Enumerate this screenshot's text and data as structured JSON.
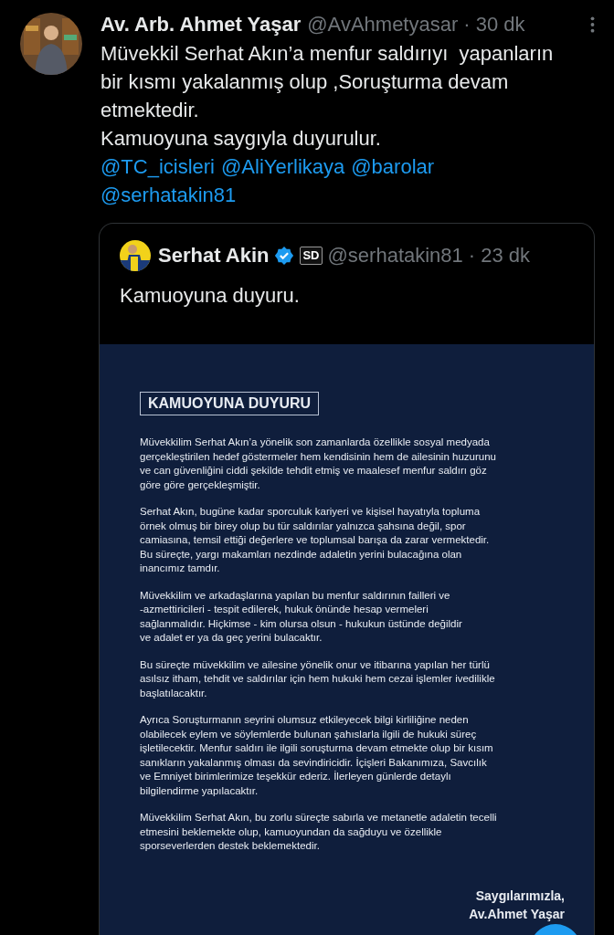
{
  "tweet": {
    "name": "Av. Arb. Ahmet Yaşar",
    "handle": "@AvAhmetyasar",
    "time": "· 30 dk",
    "text_lines": [
      "Müvekkil Serhat Akın’a menfur saldırıyı  yapanların",
      "bir kısmı yakalanmış olup ,Soruşturma devam",
      "etmektedir.",
      "Kamuoyuna saygıyla duyurulur."
    ],
    "mention_lines": [
      [
        "@TC_icisleri",
        "@AliYerlikaya",
        "@barolar"
      ],
      [
        "@serhatakin81"
      ]
    ]
  },
  "quote": {
    "name": "Serhat Akin",
    "verified": true,
    "badge": "SD",
    "handle": "@serhatakin81",
    "time": "· 23 dk",
    "text": "Kamuoyuna duyuru.",
    "document": {
      "heading": "KAMUOYUNA DUYURU",
      "paragraphs": [
        [
          "Müvekkilim Serhat Akın’a yönelik son zamanlarda özellikle sosyal medyada",
          "gerçekleştirilen hedef göstermeler hem kendisinin hem de ailesinin huzurunu",
          "ve can güvenliğini ciddi şekilde tehdit etmiş ve maalesef menfur saldırı göz",
          "göre göre gerçekleşmiştir."
        ],
        [
          "Serhat Akın, bugüne kadar sporculuk kariyeri ve kişisel hayatıyla topluma",
          "örnek olmuş bir birey olup bu tür saldırılar yalnızca şahsına değil, spor",
          "camiasına, temsil ettiği değerlere ve toplumsal barışa da zarar vermektedir.",
          "Bu süreçte, yargı makamları nezdinde adaletin yerini bulacağına olan",
          "inancımız tamdır."
        ],
        [
          "Müvekkilim ve arkadaşlarına yapılan bu menfur saldırının failleri ve",
          "-azmettiricileri - tespit edilerek, hukuk önünde hesap vermeleri",
          "sağlanmalıdır. Hiçkimse - kim olursa olsun - hukukun üstünde değildir",
          "ve adalet er ya da geç yerini bulacaktır."
        ],
        [
          "Bu süreçte müvekkilim ve ailesine yönelik onur ve itibarına yapılan her türlü",
          "asılsız itham, tehdit ve saldırılar için hem hukuki hem cezai işlemler ivedilikle",
          "başlatılacaktır."
        ],
        [
          "Ayrıca Soruşturmanın seyrini olumsuz etkileyecek bilgi kirliliğine neden",
          "olabilecek eylem ve söylemlerde bulunan şahıslarla ilgili de hukuki süreç",
          "işletilecektir. Menfur saldırı ile ilgili soruşturma devam etmekte olup bir kısım",
          "sanıkların yakalanmış olması da sevindiricidir. İçişleri Bakanımıza, Savcılık",
          "ve Emniyet birimlerimize teşekkür ederiz. İlerleyen günlerde detaylı",
          "bilgilendirme yapılacaktır."
        ],
        [
          "Müvekkilim Serhat Akın, bu zorlu süreçte sabırla ve metanetle adaletin tecelli",
          "etmesini beklemekte olup, kamuoyundan da sağduyu ve özellikle",
          "sporseverlerden destek beklemektedir."
        ]
      ],
      "signature": [
        "Saygılarımızla,",
        "Av.Ahmet Yaşar"
      ]
    }
  }
}
